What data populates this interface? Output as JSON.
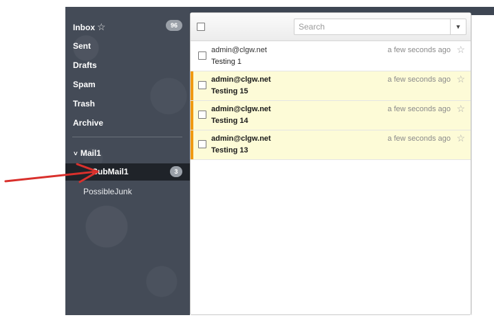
{
  "sidebar": {
    "items": [
      {
        "label": "Inbox",
        "count": "96"
      },
      {
        "label": "Sent"
      },
      {
        "label": "Drafts"
      },
      {
        "label": "Spam"
      },
      {
        "label": "Trash"
      },
      {
        "label": "Archive"
      }
    ],
    "inbox_star_icon": "☆",
    "folder": {
      "chevron": "˅",
      "label": "Mail1",
      "children": [
        {
          "label": "SubMail1",
          "count": "3"
        },
        {
          "label": "PossibleJunk"
        }
      ]
    }
  },
  "toolbar": {
    "search_placeholder": "Search",
    "dropdown_icon": "▼"
  },
  "messages": [
    {
      "from": "admin@clgw.net",
      "subject": "Testing 1",
      "time": "a few seconds ago",
      "unread": false
    },
    {
      "from": "admin@clgw.net",
      "subject": "Testing 15",
      "time": "a few seconds ago",
      "unread": true
    },
    {
      "from": "admin@clgw.net",
      "subject": "Testing 14",
      "time": "a few seconds ago",
      "unread": true
    },
    {
      "from": "admin@clgw.net",
      "subject": "Testing 13",
      "time": "a few seconds ago",
      "unread": true
    }
  ],
  "star_icon": "☆",
  "colors": {
    "sidebar_bg": "#444b57",
    "selected_folder_bg": "#1f2329",
    "unread_row_bg": "#fdfbd7",
    "unread_marker": "#f09a12",
    "annotation_arrow": "#d9302c"
  }
}
